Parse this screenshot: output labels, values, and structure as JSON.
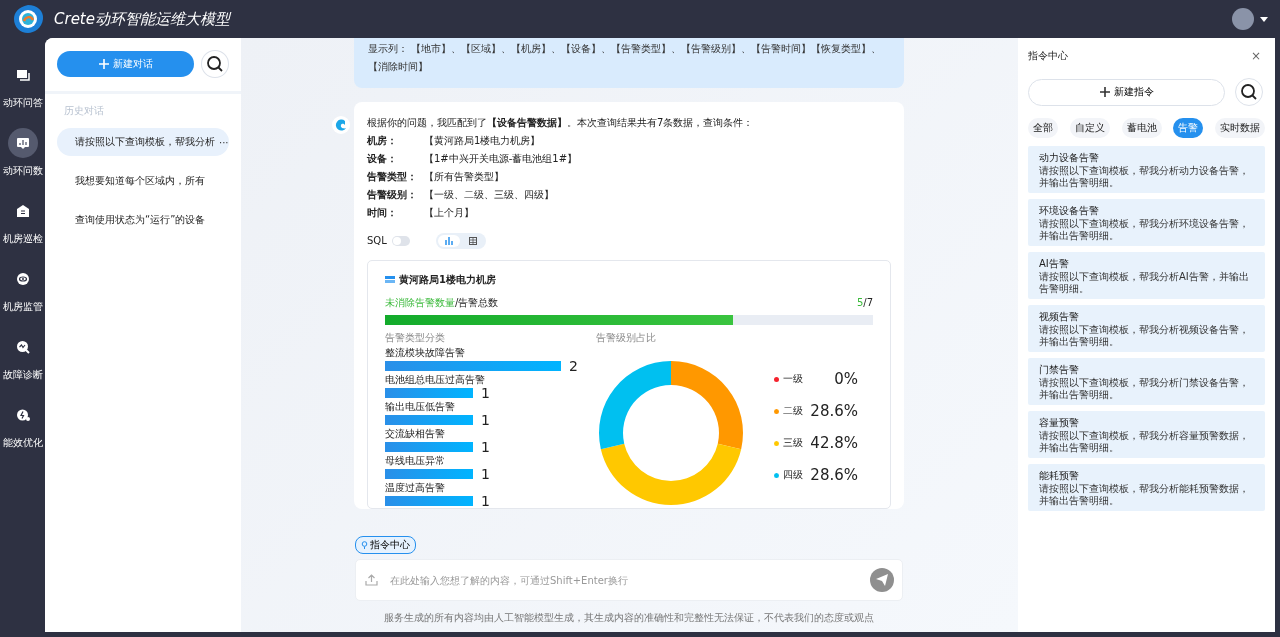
{
  "app": {
    "title": "Crete动环智能运维大模型"
  },
  "nav": [
    {
      "label": "动环问答",
      "selected": false
    },
    {
      "label": "动环问数",
      "selected": true
    },
    {
      "label": "机房巡检",
      "selected": false
    },
    {
      "label": "机房监管",
      "selected": false
    },
    {
      "label": "故障诊断",
      "selected": false
    },
    {
      "label": "能效优化",
      "selected": false
    }
  ],
  "sidebar": {
    "new_button": "新建对话",
    "history_title": "历史对话",
    "items": [
      {
        "text": "请按照以下查询模板，帮我分析",
        "selected": true,
        "more": "···"
      },
      {
        "text": "我想要知道每个区域内，所有",
        "selected": false
      },
      {
        "text": "查询使用状态为“运行”的设备",
        "selected": false
      }
    ]
  },
  "chat": {
    "user_message": "显示列：  【地市】、【区域】、【机房】、【设备】、【告警类型】、【告警级别】、【告警时间】【恢复类型】、【消除时间】",
    "answer": {
      "intro": "根据你的问题，我匹配到了**【设备告警数据】**。本次查询结果共有7条数据，查询条件：",
      "conditions": [
        {
          "label": "机房：",
          "value": "【黄河路局1楼电力机房】"
        },
        {
          "label": "设备：",
          "value": "【1#中兴开关电源-蓄电池组1#】"
        },
        {
          "label": "告警类型：",
          "value": "【所有告警类型】"
        },
        {
          "label": "告警级别：",
          "value": "【一级、二级、三级、四级】"
        },
        {
          "label": "时间：",
          "value": "【上个月】"
        }
      ],
      "sql_label": "SQL",
      "sql_on": false,
      "views": [
        {
          "kind": "chart",
          "selected": true
        },
        {
          "kind": "table",
          "selected": false
        }
      ],
      "result": {
        "room": "黄河路局1楼电力机房",
        "unresolved_label": "未消除告警数量",
        "total_label": "/告警总数",
        "count": "5",
        "total": "/7",
        "level": 0.714,
        "type_chart": {
          "title": "告警类型分类",
          "items": [
            {
              "name": "整流模块故障告警",
              "count": "2"
            },
            {
              "name": "电池组总电压过高告警",
              "count": "1"
            },
            {
              "name": "输出电压低告警",
              "count": "1"
            },
            {
              "name": "交流缺相告警",
              "count": "1"
            },
            {
              "name": "母线电压异常",
              "count": "1"
            },
            {
              "name": "温度过高告警",
              "count": "1"
            }
          ]
        },
        "level_chart": {
          "chart_data": {
            "type": "donut",
            "title": "告警级别占比",
            "categories": [
              "一级",
              "二级",
              "三级",
              "四级"
            ],
            "values": [
              0,
              28.6,
              42.8,
              28.6
            ]
          },
          "legend": [
            {
              "percent": "0%",
              "color": "#f5222d"
            },
            {
              "percent": "28.6%",
              "color": "#ff9800"
            },
            {
              "percent": "42.8%",
              "color": "#ffc800"
            },
            {
              "percent": "28.6%",
              "color": "#00c0f0"
            }
          ]
        }
      }
    },
    "command_chip": "指令中心",
    "input": {
      "placeholder": "在此处输入您想了解的内容，可通过Shift+Enter换行"
    },
    "disclaimer": "服务生成的所有内容均由人工智能模型生成，其生成内容的准确性和完整性无法保证，不代表我们的态度或观点"
  },
  "command_center": {
    "title": "指令中心",
    "close": "×",
    "new_button": "新建指令",
    "tabs": [
      {
        "label": "全部",
        "selected": false
      },
      {
        "label": "自定义",
        "selected": false
      },
      {
        "label": "蓄电池",
        "selected": false
      },
      {
        "label": "告警",
        "selected": true
      },
      {
        "label": "实时数据",
        "selected": false
      }
    ],
    "cards": [
      {
        "title": "动力设备告警",
        "desc": "请按照以下查询模板，帮我分析动力设备告警，并输出告警明细。"
      },
      {
        "title": "环境设备告警",
        "desc": "请按照以下查询模板，帮我分析环境设备告警，并输出告警明细。"
      },
      {
        "title": "AI告警",
        "desc": "请按照以下查询模板，帮我分析AI告警，并输出告警明细。"
      },
      {
        "title": "视频告警",
        "desc": "请按照以下查询模板，帮我分析视频设备告警，并输出告警明细。"
      },
      {
        "title": "门禁告警",
        "desc": "请按照以下查询模板，帮我分析门禁设备告警，并输出告警明细。"
      },
      {
        "title": "容量预警",
        "desc": "请按照以下查询模板，帮我分析容量预警数据，并输出告警明细。"
      },
      {
        "title": "能耗预警",
        "desc": "请按照以下查询模板，帮我分析能耗预警数据，并输出告警明细。"
      }
    ]
  }
}
